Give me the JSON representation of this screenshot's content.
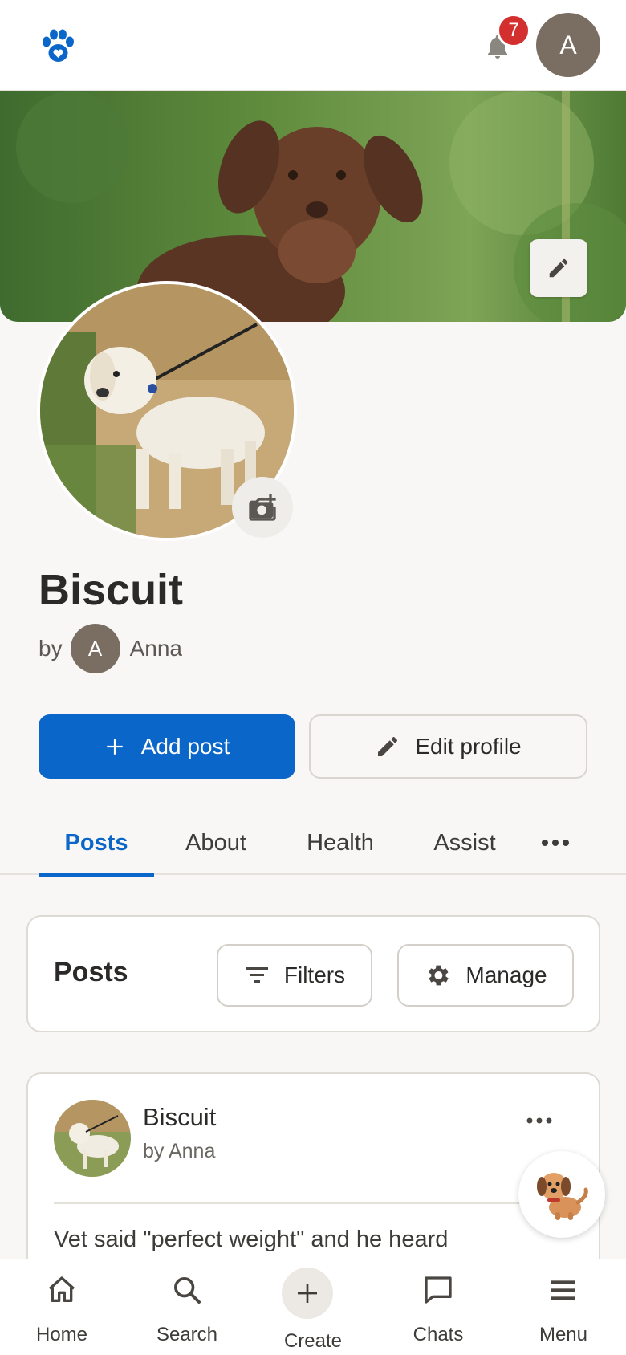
{
  "header": {
    "notification_count": "7",
    "user_initial": "A"
  },
  "profile": {
    "name": "Biscuit",
    "by_label": "by",
    "owner_initial": "A",
    "owner_name": "Anna"
  },
  "actions": {
    "add_post": "Add post",
    "edit_profile": "Edit profile"
  },
  "tabs": [
    {
      "label": "Posts",
      "active": true
    },
    {
      "label": "About",
      "active": false
    },
    {
      "label": "Health",
      "active": false
    },
    {
      "label": "Assist",
      "active": false
    }
  ],
  "posts_section": {
    "title": "Posts",
    "filters_label": "Filters",
    "manage_label": "Manage"
  },
  "post": {
    "author": "Biscuit",
    "byline": "by Anna",
    "text": "Vet said \"perfect weight\" and he heard"
  },
  "bottom_nav": [
    {
      "label": "Home",
      "icon": "home-icon"
    },
    {
      "label": "Search",
      "icon": "search-icon"
    },
    {
      "label": "Create",
      "icon": "plus-icon"
    },
    {
      "label": "Chats",
      "icon": "chat-icon"
    },
    {
      "label": "Menu",
      "icon": "menu-icon"
    }
  ],
  "colors": {
    "accent": "#0a66c8",
    "badge": "#d32f2f",
    "avatar": "#7a6d62",
    "background": "#f8f7f5"
  }
}
